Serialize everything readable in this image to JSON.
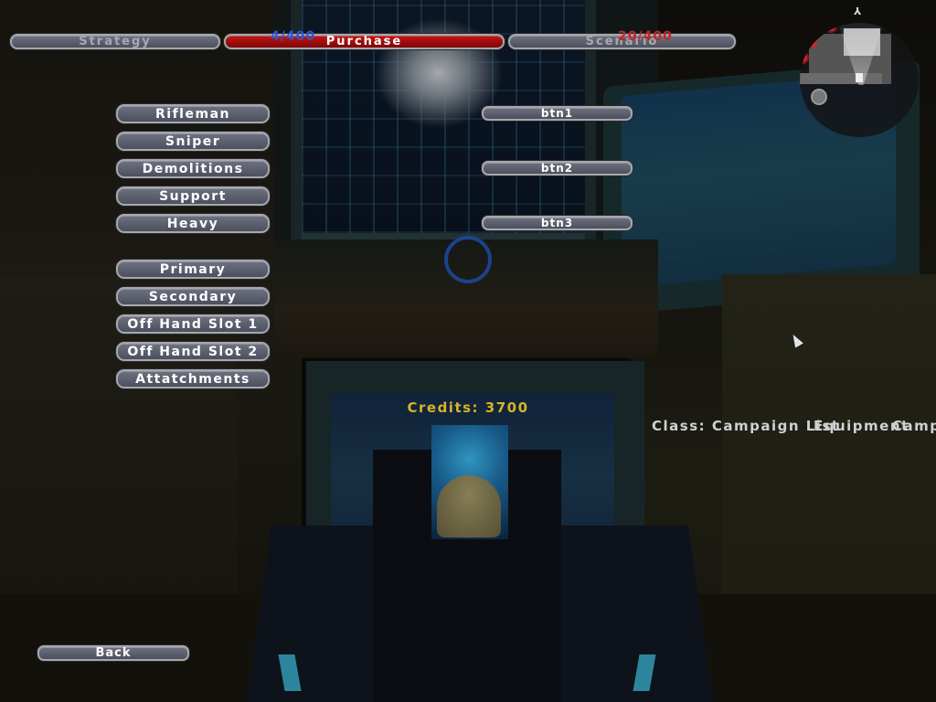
{
  "tabs": [
    {
      "label": "Strategy",
      "active": false
    },
    {
      "label": "Purchase",
      "active": true
    },
    {
      "label": "Scenario",
      "active": false
    }
  ],
  "team_counts": {
    "blue": {
      "text": "4/400",
      "color": "#2a56d8"
    },
    "red": {
      "text": "20/400",
      "color": "#c0262a"
    }
  },
  "class_buttons": [
    "Rifleman",
    "Sniper",
    "Demolitions",
    "Support",
    "Heavy"
  ],
  "equipment_buttons": [
    "Primary",
    "Secondary",
    "Off Hand Slot 1",
    "Off Hand Slot 2",
    "Attatchments"
  ],
  "item_buttons": [
    "btn1",
    "btn2",
    "btn3"
  ],
  "credits": {
    "text": "Credits: 3700",
    "color": "#d4b52a"
  },
  "info_labels": {
    "class": "Class: Campaign List",
    "equipment": "Equipment",
    "campaign": "Campaign"
  },
  "back_label": "Back",
  "minimap": {
    "north_marker": "north-arrow",
    "enemy_markers": 3
  },
  "icons": {
    "reticle": "crosshair-reticle",
    "cursor": "mouse-pointer",
    "north": "⅄"
  }
}
